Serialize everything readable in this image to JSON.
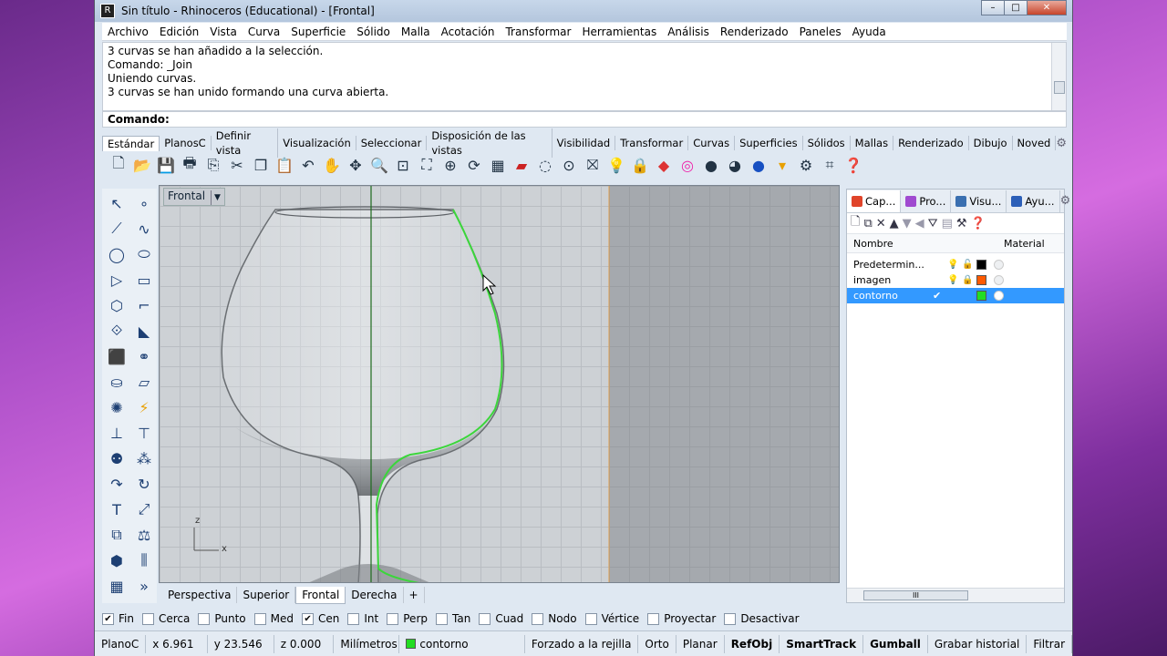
{
  "window": {
    "title": "Sin título - Rhinoceros (Educational) - [Frontal]",
    "icon": "rhino-icon"
  },
  "menu": [
    "Archivo",
    "Edición",
    "Vista",
    "Curva",
    "Superficie",
    "Sólido",
    "Malla",
    "Acotación",
    "Transformar",
    "Herramientas",
    "Análisis",
    "Renderizado",
    "Paneles",
    "Ayuda"
  ],
  "history": [
    "3 curvas se han añadido a la selección.",
    "Comando: _Join",
    "Uniendo curvas.",
    "3 curvas se han unido formando una curva abierta."
  ],
  "command": {
    "label": "Comando:"
  },
  "toolbar_tabs": [
    "Estándar",
    "PlanosC",
    "Definir vista",
    "Visualización",
    "Seleccionar",
    "Disposición de las vistas",
    "Visibilidad",
    "Transformar",
    "Curvas",
    "Superficies",
    "Sólidos",
    "Mallas",
    "Renderizado",
    "Dibujo",
    "Noved"
  ],
  "viewport": {
    "label": "Frontal",
    "axis_z": "z",
    "axis_x": "x"
  },
  "view_tabs": [
    "Perspectiva",
    "Superior",
    "Frontal",
    "Derecha"
  ],
  "panel": {
    "tabs": [
      "Cap...",
      "Pro...",
      "Visu...",
      "Ayu..."
    ],
    "headers": {
      "name": "Nombre",
      "material": "Material"
    },
    "layers": [
      {
        "name": "Predetermin...",
        "color": "#000000",
        "current": false
      },
      {
        "name": "imagen",
        "color": "#ff5a00",
        "current": false
      },
      {
        "name": "contorno",
        "color": "#22dd22",
        "current": true
      }
    ],
    "scroll_glyph": "III"
  },
  "osnaps": [
    {
      "label": "Fin",
      "checked": true
    },
    {
      "label": "Cerca",
      "checked": false
    },
    {
      "label": "Punto",
      "checked": false
    },
    {
      "label": "Med",
      "checked": false
    },
    {
      "label": "Cen",
      "checked": true
    },
    {
      "label": "Int",
      "checked": false
    },
    {
      "label": "Perp",
      "checked": false
    },
    {
      "label": "Tan",
      "checked": false
    },
    {
      "label": "Cuad",
      "checked": false
    },
    {
      "label": "Nodo",
      "checked": false
    },
    {
      "label": "Vértice",
      "checked": false
    },
    {
      "label": "Proyectar",
      "checked": false
    },
    {
      "label": "Desactivar",
      "checked": false
    }
  ],
  "status": {
    "cplane": "PlanoC",
    "x": "x 6.961",
    "y": "y 23.546",
    "z": "z 0.000",
    "units": "Milímetros",
    "layer": "contorno",
    "layer_color": "#22dd22",
    "toggles": [
      "Forzado a la rejilla",
      "Orto",
      "Planar",
      "RefObj",
      "SmartTrack",
      "Gumball",
      "Grabar historial",
      "Filtrar"
    ]
  }
}
